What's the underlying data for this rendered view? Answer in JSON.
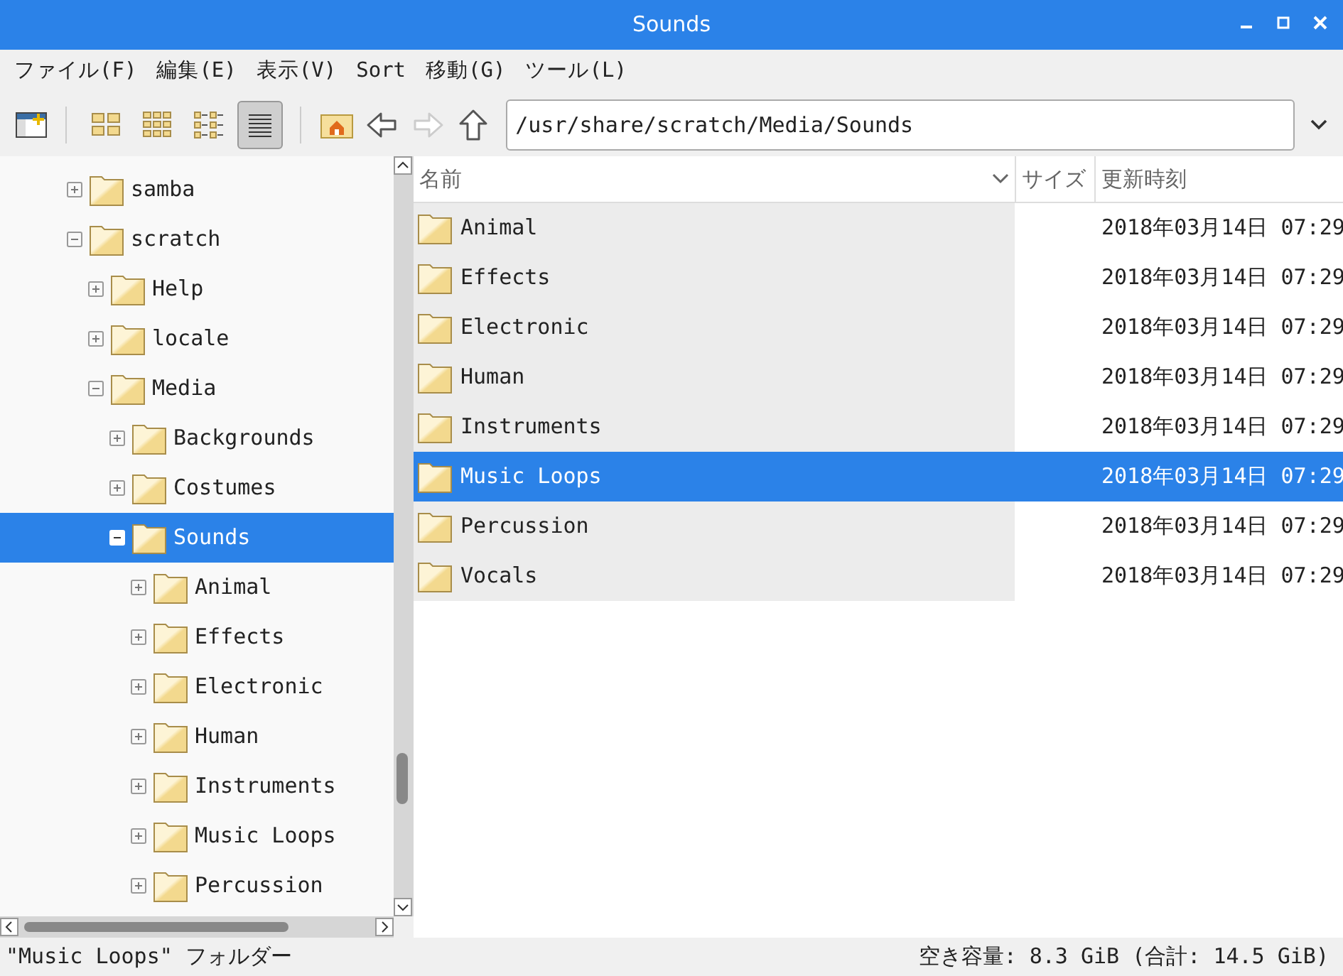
{
  "window": {
    "title": "Sounds"
  },
  "menu": [
    "ファイル(F)",
    "編集(E)",
    "表示(V)",
    "Sort",
    "移動(G)",
    "ツール(L)"
  ],
  "toolbar": {
    "views": [
      {
        "selected": false
      },
      {
        "selected": false
      },
      {
        "selected": false
      },
      {
        "selected": true
      }
    ],
    "forward_disabled": true,
    "path": "/usr/share/scratch/Media/Sounds"
  },
  "tree": [
    {
      "label": "samba",
      "expanded": false,
      "selected": false
    },
    {
      "label": "scratch",
      "expanded": true,
      "selected": false,
      "children": [
        {
          "label": "Help",
          "expanded": false,
          "selected": false
        },
        {
          "label": "locale",
          "expanded": false,
          "selected": false
        },
        {
          "label": "Media",
          "expanded": true,
          "selected": false,
          "children": [
            {
              "label": "Backgrounds",
              "expanded": false,
              "selected": false
            },
            {
              "label": "Costumes",
              "expanded": false,
              "selected": false
            },
            {
              "label": "Sounds",
              "expanded": true,
              "selected": true,
              "children": [
                {
                  "label": "Animal",
                  "expanded": false,
                  "selected": false
                },
                {
                  "label": "Effects",
                  "expanded": false,
                  "selected": false
                },
                {
                  "label": "Electronic",
                  "expanded": false,
                  "selected": false
                },
                {
                  "label": "Human",
                  "expanded": false,
                  "selected": false
                },
                {
                  "label": "Instruments",
                  "expanded": false,
                  "selected": false
                },
                {
                  "label": "Music Loops",
                  "expanded": false,
                  "selected": false
                },
                {
                  "label": "Percussion",
                  "expanded": false,
                  "selected": false
                }
              ]
            }
          ]
        }
      ]
    }
  ],
  "columns": [
    "名前",
    "サイズ",
    "更新時刻"
  ],
  "rows": [
    {
      "name": "Animal",
      "modified": "2018年03月14日 07:29",
      "selected": false
    },
    {
      "name": "Effects",
      "modified": "2018年03月14日 07:29",
      "selected": false
    },
    {
      "name": "Electronic",
      "modified": "2018年03月14日 07:29",
      "selected": false
    },
    {
      "name": "Human",
      "modified": "2018年03月14日 07:29",
      "selected": false
    },
    {
      "name": "Instruments",
      "modified": "2018年03月14日 07:29",
      "selected": false
    },
    {
      "name": "Music Loops",
      "modified": "2018年03月14日 07:29",
      "selected": true
    },
    {
      "name": "Percussion",
      "modified": "2018年03月14日 07:29",
      "selected": false
    },
    {
      "name": "Vocals",
      "modified": "2018年03月14日 07:29",
      "selected": false
    }
  ],
  "status_bar": {
    "left": "\"Music Loops\" フォルダー",
    "right": "空き容量: 8.3 GiB (合計: 14.5 GiB)"
  }
}
